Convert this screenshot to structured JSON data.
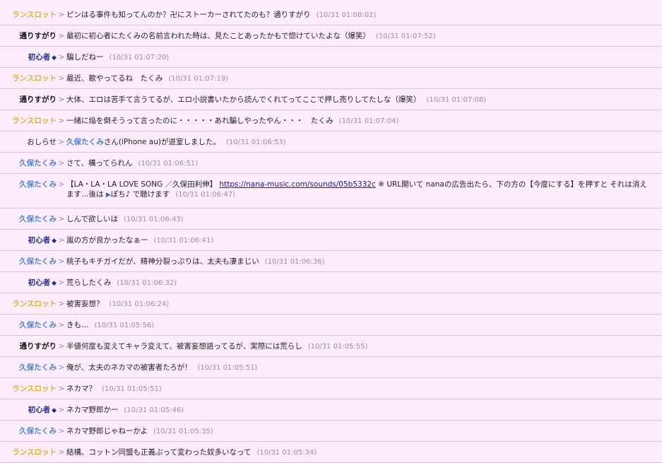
{
  "colors": {
    "background": "#fcecfc",
    "divider": "#d9c3d9",
    "lancelot": "#e0b323",
    "toorisugari": "#111111",
    "shoshinsha": "#1e2f8f",
    "kubo": "#4a82d4",
    "timestamp": "#9a8f9a",
    "link": "#1a1aa6"
  },
  "messages": [
    {
      "name": "ランスロット",
      "cls": "c-lancelot",
      "mark": "",
      "text": "ピンはる事件も知ってんのか？卍にストーカーされてたのも？通りすがり",
      "time": "(10/31 01:08:02)"
    },
    {
      "name": "通りすがり",
      "cls": "c-toori",
      "mark": "",
      "text": "最初に初心者にたくみの名前言われた時は、見たことあったかもで惚けていたよな（爆笑）",
      "time": "(10/31 01:07:52)"
    },
    {
      "name": "初心者",
      "cls": "c-shoshin",
      "mark": "◆",
      "text": "騙しだねー",
      "time": "(10/31 01:07:20)"
    },
    {
      "name": "ランスロット",
      "cls": "c-lancelot",
      "mark": "",
      "text": "最近、歌やってるね　たくみ",
      "time": "(10/31 01:07:19)"
    },
    {
      "name": "通りすがり",
      "cls": "c-toori",
      "mark": "",
      "text": "大体、エロは苦手て言うてるが、エロ小説書いたから読んでくれてってここで押し売りしてたしな（爆笑）",
      "time": "(10/31 01:07:08)"
    },
    {
      "name": "ランスロット",
      "cls": "c-lancelot",
      "mark": "",
      "text": "一緒に焔を倒そうって言ったのに・・・・・あれ騙しやったやん・・・　たくみ",
      "time": "(10/31 01:07:04)"
    },
    {
      "name": "おしらせ",
      "cls": "c-sys",
      "mark": "",
      "type": "notice",
      "who": "久保たくみ",
      "text": "さん(iPhone au)が退室しました。",
      "time": "(10/31 01:06:53)"
    },
    {
      "name": "久保たくみ",
      "cls": "c-kubo",
      "mark": "",
      "text": "さて、構ってられん",
      "time": "(10/31 01:06:51)"
    },
    {
      "name": "久保たくみ",
      "cls": "c-kubo",
      "mark": "",
      "type": "link",
      "pre": "【LA・LA・LA LOVE SONG ／久保田利伸】",
      "link": "https://nana-music.com/sounds/05b5332c",
      "post": " ※ URL開いて nanaの広告出たら、下の方の【今度にする】を押すと それは消えます…後は ",
      "tri": "▶",
      "post2": "ぽち♪ で聴けます",
      "time": "(10/31 01:06:47)"
    },
    {
      "name": "久保たくみ",
      "cls": "c-kubo",
      "mark": "",
      "text": "しんで欲しいは",
      "time": "(10/31 01:06:43)"
    },
    {
      "name": "初心者",
      "cls": "c-shoshin",
      "mark": "◆",
      "text": "嵐の方が良かったなぁー",
      "time": "(10/31 01:06:41)"
    },
    {
      "name": "久保たくみ",
      "cls": "c-kubo",
      "mark": "",
      "text": "桃子もキチガイだが、精神分裂っぷりは、太夫も凄まじい",
      "time": "(10/31 01:06:36)"
    },
    {
      "name": "初心者",
      "cls": "c-shoshin",
      "mark": "◆",
      "text": "荒らしたくみ",
      "time": "(10/31 01:06:32)"
    },
    {
      "name": "ランスロット",
      "cls": "c-lancelot",
      "mark": "",
      "text": "被害妄想？",
      "time": "(10/31 01:06:24)"
    },
    {
      "name": "久保たくみ",
      "cls": "c-kubo",
      "mark": "",
      "text": "きも…",
      "time": "(10/31 01:05:56)"
    },
    {
      "name": "通りすがり",
      "cls": "c-toori",
      "mark": "",
      "text": "半値何度も変えてキャラ変えて、被害妄想語ってるが、実際には荒らし",
      "time": "(10/31 01:05:55)"
    },
    {
      "name": "久保たくみ",
      "cls": "c-kubo",
      "mark": "",
      "text": "俺が、太夫のネカマの被害者たろが！",
      "time": "(10/31 01:05:51)"
    },
    {
      "name": "ランスロット",
      "cls": "c-lancelot",
      "mark": "",
      "text": "ネカマ？",
      "time": "(10/31 01:05:51)"
    },
    {
      "name": "初心者",
      "cls": "c-shoshin",
      "mark": "◆",
      "text": "ネカマ野郎かー",
      "time": "(10/31 01:05:46)"
    },
    {
      "name": "久保たくみ",
      "cls": "c-kubo",
      "mark": "",
      "text": "ネカマ野郎じゃねーかよ",
      "time": "(10/31 01:05:35)"
    },
    {
      "name": "ランスロット",
      "cls": "c-lancelot",
      "mark": "",
      "text": "結構、コットン同盟も正義ぶって変わった奴多いなって",
      "time": "(10/31 01:05:34)"
    }
  ],
  "arrow": ">"
}
